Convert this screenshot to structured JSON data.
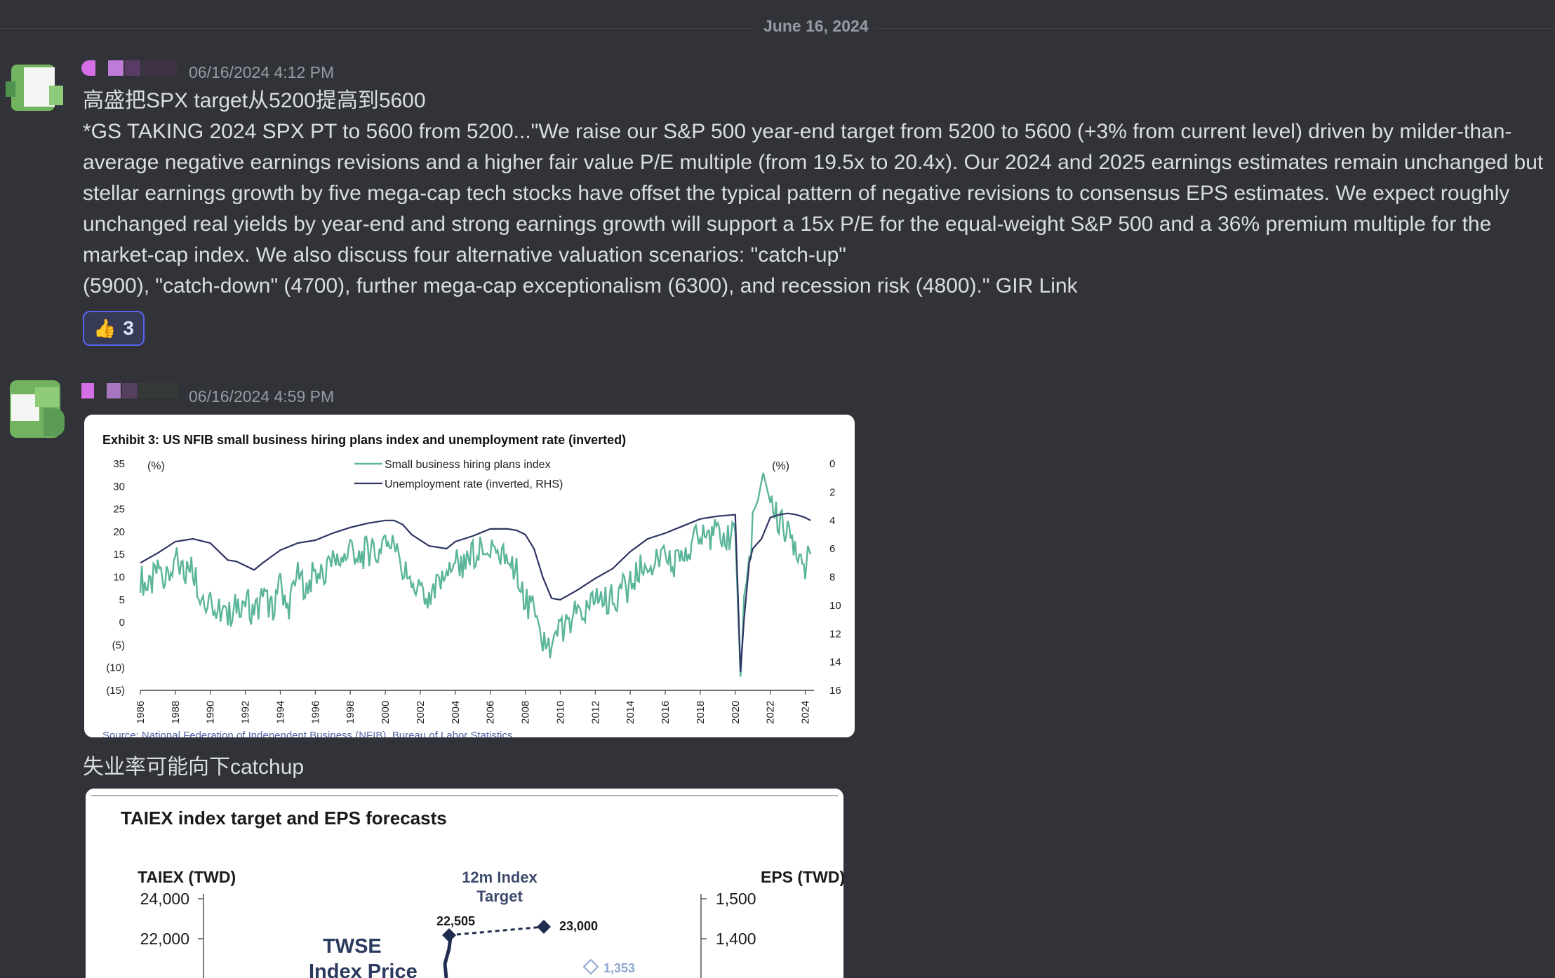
{
  "divider": {
    "date": "June 16, 2024"
  },
  "messages": [
    {
      "timestamp": "06/16/2024 4:12 PM",
      "title": "高盛把SPX target从5200提高到5600",
      "body": "*GS TAKING 2024 SPX PT to 5600 from 5200...\"We raise our S&P 500 year-end target from 5200 to 5600 (+3% from current level) driven by milder-than-average negative earnings revisions and a higher fair value P/E multiple (from 19.5x to 20.4x). Our 2024 and 2025 earnings estimates remain unchanged but stellar earnings growth by five mega-cap tech stocks have offset the typical pattern of negative revisions to consensus EPS estimates. We expect roughly unchanged real yields by year-end and strong earnings growth will support a 15x P/E for the equal-weight S&P 500 and a 36% premium multiple for the market-cap index. We also discuss four alternative valuation scenarios: \"catch-up\"",
      "body_tail": "(5900), \"catch-down\" (4700), further mega-cap exceptionalism (6300), and recession risk (4800).\" GIR Link",
      "reaction": {
        "emoji": "👍",
        "count": "3"
      }
    },
    {
      "timestamp": "06/16/2024 4:59 PM",
      "caption": "失业率可能向下catchup"
    }
  ],
  "chart_data": [
    {
      "type": "line",
      "title": "Exhibit 3: US NFIB small business hiring plans index and unemployment rate (inverted)",
      "ylabel_left": "(%)",
      "ylabel_right": "(%)",
      "source": "Source: National Federation of Independent Business (NFIB), Bureau of Labor Statistics",
      "y_left_ticks": [
        "35",
        "30",
        "25",
        "20",
        "15",
        "10",
        "5",
        "0",
        "(5)",
        "(10)",
        "(15)"
      ],
      "y_right_ticks": [
        "0",
        "2",
        "4",
        "6",
        "8",
        "10",
        "12",
        "14",
        "16"
      ],
      "x_ticks": [
        "1986",
        "1988",
        "1990",
        "1992",
        "1994",
        "1996",
        "1998",
        "2000",
        "2002",
        "2004",
        "2006",
        "2008",
        "2010",
        "2012",
        "2014",
        "2016",
        "2018",
        "2020",
        "2022",
        "2024"
      ],
      "ylim_left": [
        -15,
        35
      ],
      "ylim_right": [
        16,
        0
      ],
      "xlim": [
        1986,
        2024.5
      ],
      "colors": {
        "hiring": "#5bb59a",
        "unemployment": "#2f3563"
      },
      "series": [
        {
          "name": "Small business hiring plans index",
          "axis": "left",
          "x": [
            1986,
            1986.5,
            1987,
            1987.5,
            1988,
            1988.5,
            1989,
            1989.5,
            1990,
            1990.5,
            1991,
            1991.5,
            1992,
            1992.5,
            1993,
            1993.5,
            1994,
            1994.5,
            1995,
            1995.5,
            1996,
            1996.5,
            1997,
            1997.5,
            1998,
            1998.5,
            1999,
            1999.5,
            2000,
            2000.5,
            2001,
            2001.5,
            2002,
            2002.5,
            2003,
            2003.5,
            2004,
            2004.5,
            2005,
            2005.5,
            2006,
            2006.5,
            2007,
            2007.5,
            2008,
            2008.5,
            2009,
            2009.5,
            2010,
            2010.5,
            2011,
            2011.5,
            2012,
            2012.5,
            2013,
            2013.5,
            2014,
            2014.5,
            2015,
            2015.5,
            2016,
            2016.5,
            2017,
            2017.5,
            2018,
            2018.5,
            2019,
            2019.5,
            2020,
            2020.3,
            2020.5,
            2020.8,
            2021,
            2021.3,
            2021.6,
            2022,
            2022.5,
            2023,
            2023.5,
            2024,
            2024.3
          ],
          "values": [
            10,
            7,
            12,
            9,
            14,
            11,
            12,
            6,
            5,
            3,
            1,
            4,
            5,
            2,
            6,
            3,
            8,
            4,
            10,
            8,
            11,
            10,
            15,
            12,
            17,
            14,
            16,
            14,
            20,
            16,
            12,
            8,
            6,
            4,
            8,
            10,
            14,
            12,
            15,
            17,
            17,
            15,
            14,
            12,
            5,
            2,
            -5,
            -7,
            -1,
            -1,
            3,
            2,
            5,
            5,
            5,
            7,
            8,
            12,
            12,
            14,
            14,
            12,
            17,
            16,
            20,
            19,
            20,
            18,
            20,
            -12,
            3,
            12,
            22,
            28,
            31,
            27,
            22,
            20,
            17,
            12,
            15
          ]
        },
        {
          "name": "Unemployment rate (inverted, RHS)",
          "axis": "right",
          "x": [
            1986,
            1987,
            1988,
            1989,
            1990,
            1991,
            1991.5,
            1992.5,
            1993,
            1994,
            1995,
            1996,
            1997,
            1998,
            1999,
            2000,
            2000.5,
            2001,
            2001.5,
            2002.5,
            2003.5,
            2004,
            2005,
            2006,
            2007,
            2007.5,
            2008,
            2008.5,
            2009,
            2009.5,
            2010,
            2011,
            2012,
            2013,
            2014,
            2015,
            2016,
            2017,
            2018,
            2019,
            2020,
            2020.3,
            2020.5,
            2020.8,
            2021,
            2021.5,
            2022,
            2022.5,
            2023,
            2023.5,
            2024,
            2024.3
          ],
          "values": [
            7.0,
            6.3,
            5.5,
            5.3,
            5.6,
            6.8,
            6.9,
            7.5,
            7.0,
            6.1,
            5.6,
            5.4,
            4.9,
            4.5,
            4.2,
            4.0,
            4.0,
            4.3,
            5.0,
            5.8,
            6.0,
            5.5,
            5.1,
            4.6,
            4.6,
            4.7,
            5.0,
            6.0,
            8.0,
            9.5,
            9.6,
            8.9,
            8.1,
            7.4,
            6.2,
            5.3,
            4.9,
            4.4,
            3.9,
            3.7,
            3.6,
            14.7,
            11.0,
            7.0,
            6.0,
            5.3,
            3.8,
            3.6,
            3.5,
            3.6,
            3.8,
            4.0
          ]
        }
      ]
    },
    {
      "type": "line",
      "title": "TAIEX index target and EPS forecasts",
      "ylabel_left": "TAIEX (TWD)",
      "ylabel_right": "EPS (TWD)",
      "y_left_ticks": [
        "24,000",
        "22,000"
      ],
      "y_right_ticks": [
        "1,500",
        "1,400"
      ],
      "annotations": [
        "12m Index",
        "Target",
        "22,505",
        "23,000",
        "1,353",
        "TWSE",
        "Index Price"
      ],
      "series": [
        {
          "name": "TWSE Index Price",
          "axis": "left"
        },
        {
          "name": "12m Index Target",
          "axis": "left",
          "values": [
            22505,
            23000
          ]
        },
        {
          "name": "EPS",
          "axis": "right",
          "values": [
            1353
          ]
        }
      ]
    }
  ]
}
